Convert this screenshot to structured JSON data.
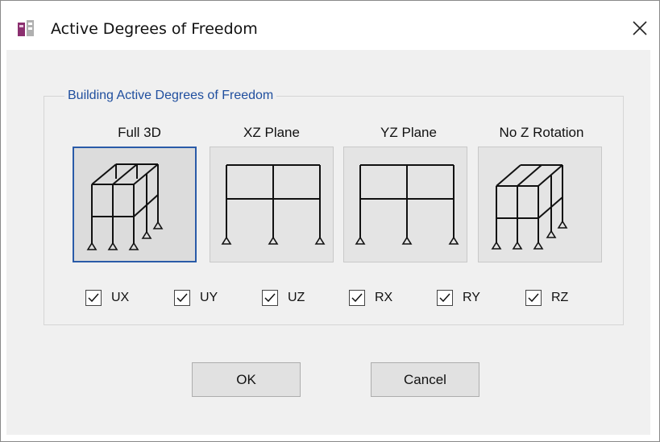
{
  "window": {
    "title": "Active Degrees of Freedom",
    "close_glyph": "×"
  },
  "group": {
    "title": "Building Active Degrees of Freedom"
  },
  "options": [
    {
      "label": "Full 3D",
      "icon": "3d-frame-icon",
      "selected": true
    },
    {
      "label": "XZ Plane",
      "icon": "xz-frame-icon",
      "selected": false
    },
    {
      "label": "YZ Plane",
      "icon": "yz-frame-icon",
      "selected": false
    },
    {
      "label": "No Z Rotation",
      "icon": "3d-frame-icon",
      "selected": false
    }
  ],
  "checkboxes": [
    {
      "label": "UX",
      "checked": true
    },
    {
      "label": "UY",
      "checked": true
    },
    {
      "label": "UZ",
      "checked": true
    },
    {
      "label": "RX",
      "checked": true
    },
    {
      "label": "RY",
      "checked": true
    },
    {
      "label": "RZ",
      "checked": true
    }
  ],
  "buttons": {
    "ok": "OK",
    "cancel": "Cancel"
  },
  "colors": {
    "accent": "#2a5ba8",
    "group_title": "#1f4e9e"
  }
}
